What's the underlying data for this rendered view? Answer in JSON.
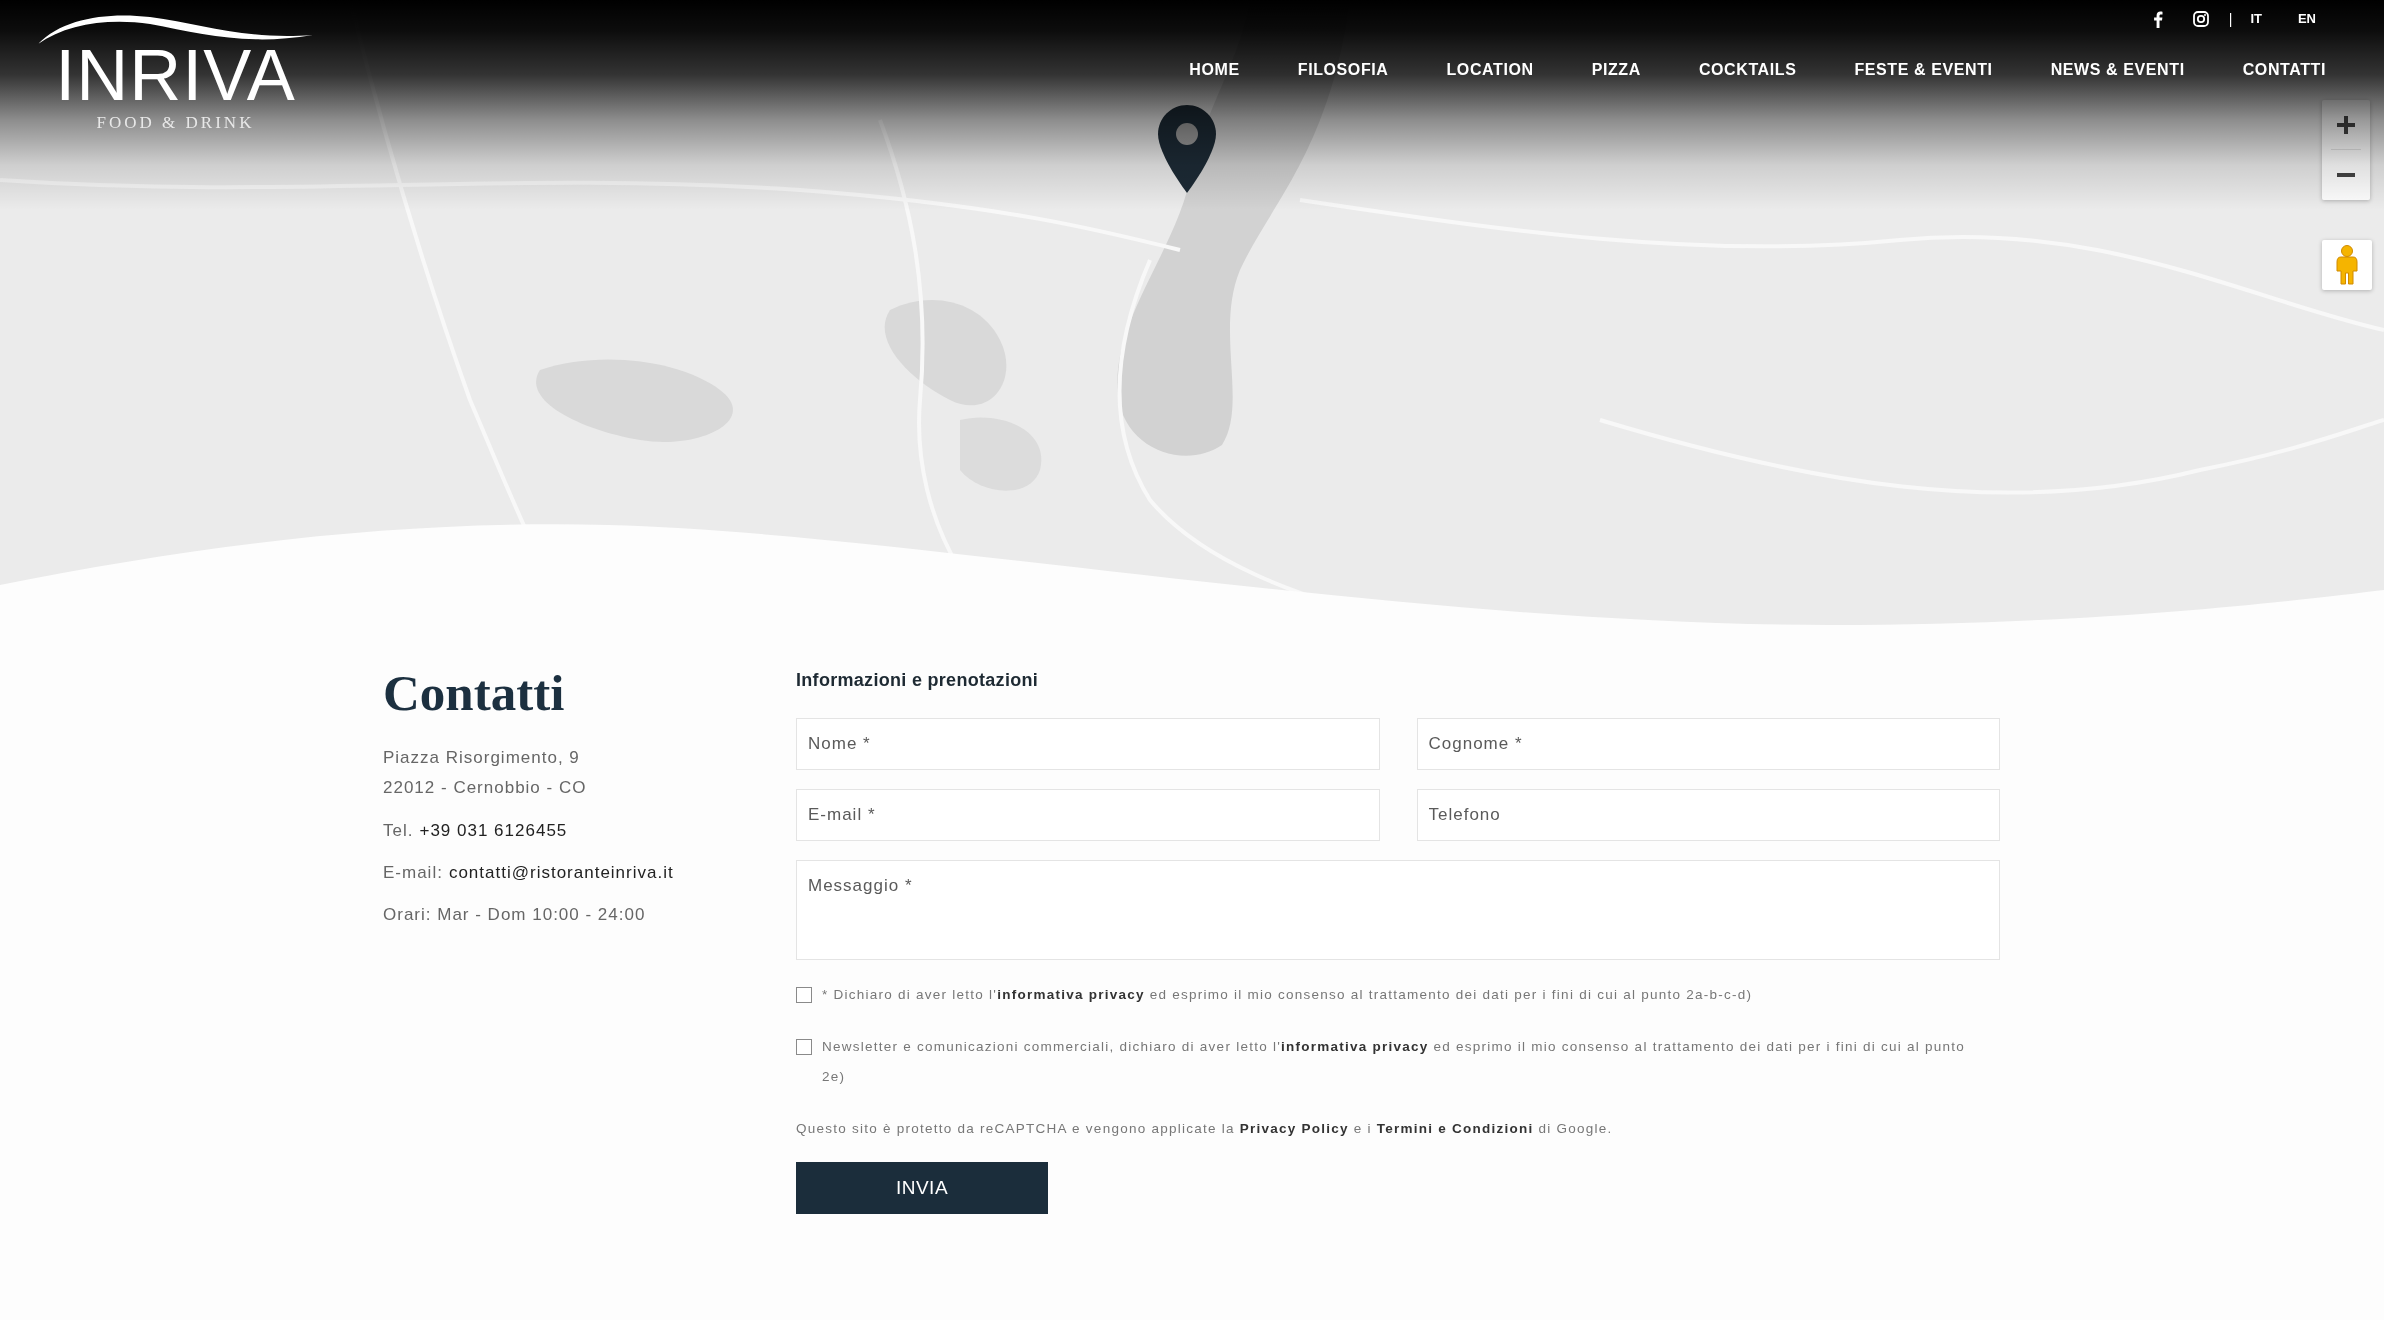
{
  "header": {
    "logo": {
      "name": "INRIVA",
      "tagline": "FOOD & DRINK"
    },
    "separator": "|",
    "languages": [
      "IT",
      "EN"
    ],
    "nav": [
      "HOME",
      "FILOSOFIA",
      "LOCATION",
      "PIZZA",
      "COCKTAILS",
      "FESTE & EVENTI",
      "NEWS & EVENTI",
      "CONTATTI"
    ]
  },
  "contact": {
    "title": "Contatti",
    "address": [
      "Piazza Risorgimento, 9",
      "22012 - Cernobbio - CO"
    ],
    "phone": {
      "label": "Tel.",
      "value": "+39 031 6126455"
    },
    "email": {
      "label": "E-mail:",
      "value": "contatti@ristoranteinriva.it"
    },
    "hours": "Orari: Mar - Dom 10:00 - 24:00"
  },
  "form": {
    "title": "Informazioni e prenotazioni",
    "fields": [
      {
        "kind": "input",
        "placeholder": "Nome *"
      },
      {
        "kind": "input",
        "placeholder": "Cognome *"
      },
      {
        "kind": "input",
        "placeholder": "E-mail *"
      },
      {
        "kind": "input",
        "placeholder": "Telefono"
      },
      {
        "kind": "textarea",
        "placeholder": "Messaggio *"
      }
    ],
    "consents": [
      {
        "checked": false,
        "parts": [
          {
            "kind": "text",
            "text": "* Dichiaro di aver letto l'"
          },
          {
            "kind": "link",
            "text": "informativa privacy"
          },
          {
            "kind": "text",
            "text": " ed esprimo il mio consenso al trattamento dei dati per i fini di cui al punto 2a-b-c-d)"
          }
        ]
      },
      {
        "checked": false,
        "parts": [
          {
            "kind": "text",
            "text": "Newsletter e comunicazioni commerciali, dichiaro di aver letto l'"
          },
          {
            "kind": "link",
            "text": "informativa privacy"
          },
          {
            "kind": "text",
            "text": " ed esprimo il mio consenso al trattamento dei dati per i fini di cui al punto 2e)"
          }
        ]
      }
    ],
    "recaptcha_notice": [
      {
        "kind": "text",
        "text": "Questo sito è protetto da reCAPTCHA e vengono applicate la "
      },
      {
        "kind": "link",
        "text": "Privacy Policy"
      },
      {
        "kind": "text",
        "text": " e i "
      },
      {
        "kind": "link",
        "text": "Termini e Condizioni"
      },
      {
        "kind": "text",
        "text": " di Google."
      }
    ],
    "submit": "INVIA"
  }
}
